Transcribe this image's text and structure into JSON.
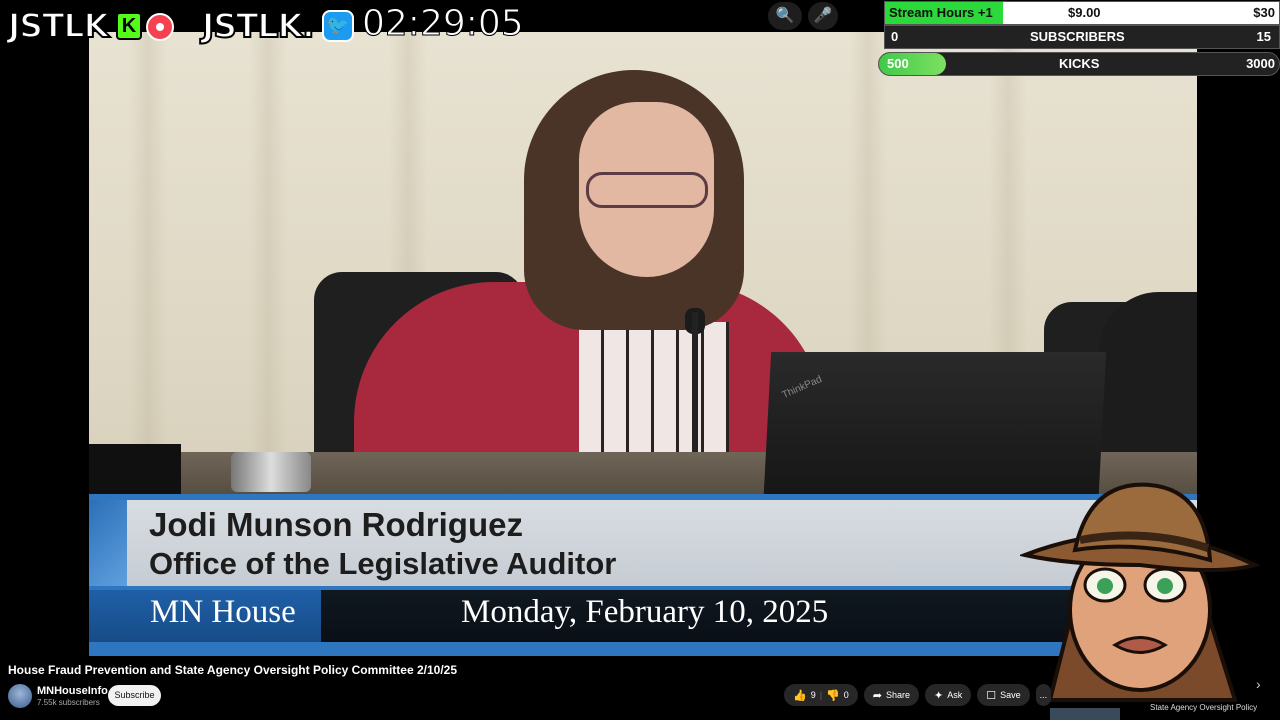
{
  "overlay": {
    "logo1": "JSTLK",
    "logo1_badge": "K",
    "logo2": "JSTLK.",
    "timer": "02:29:05"
  },
  "goals": {
    "row1": {
      "label": "Stream Hours +1",
      "mid": "$9.00",
      "right": "$30",
      "progress": 0.3
    },
    "row2": {
      "left": "0",
      "label": "SUBSCRIBERS",
      "right": "15",
      "progress": 0
    },
    "row3": {
      "left": "500",
      "label": "KICKS",
      "right": "3000",
      "progress": 0.167
    }
  },
  "lower_third": {
    "name": "Jodi Munson Rodriguez",
    "org": "Office of the Legislative Auditor",
    "channel": "MN House",
    "date": "Monday, February 10, 2025"
  },
  "video_scene": {
    "laptop_brand": "ThinkPad"
  },
  "youtube": {
    "title": "House Fraud Prevention and State Agency Oversight Policy Committee 2/10/25",
    "channel_name": "MNHouseInfo",
    "subscribers": "7.55k subscribers",
    "subscribe_label": "Subscribe",
    "like_count": "9",
    "dislike_count": "0",
    "share_label": "Share",
    "ask_label": "Ask",
    "save_label": "Save",
    "more_label": "...",
    "up_next_snippet": "State Agency Oversight Policy"
  },
  "icons": {
    "search": "search-icon",
    "mic": "microphone-icon",
    "like": "thumbs-up-icon",
    "dislike": "thumbs-down-icon",
    "share": "share-icon",
    "ask": "sparkle-icon",
    "save": "bookmark-icon",
    "next": "chevron-right-icon"
  },
  "colors": {
    "kick_green": "#53fc18",
    "twitter_blue": "#1d9bf0",
    "lower_third_blue": "#2f76c1"
  }
}
